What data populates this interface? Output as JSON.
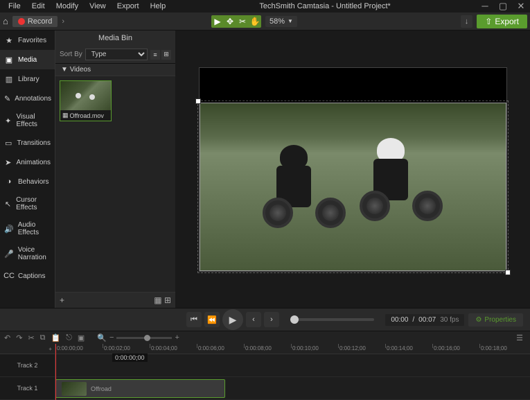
{
  "menu": {
    "file": "File",
    "edit": "Edit",
    "modify": "Modify",
    "view": "View",
    "export": "Export",
    "help": "Help"
  },
  "title": "TechSmith Camtasia - Untitled Project*",
  "toolbar": {
    "record": "Record",
    "zoom": "58%",
    "export": "Export"
  },
  "sidebar": {
    "items": [
      {
        "label": "Favorites",
        "icon": "★"
      },
      {
        "label": "Media",
        "icon": "▣"
      },
      {
        "label": "Library",
        "icon": "▥"
      },
      {
        "label": "Annotations",
        "icon": "✎"
      },
      {
        "label": "Visual Effects",
        "icon": "✦"
      },
      {
        "label": "Transitions",
        "icon": "▭"
      },
      {
        "label": "Animations",
        "icon": "➤"
      },
      {
        "label": "Behaviors",
        "icon": "◑"
      },
      {
        "label": "Cursor Effects",
        "icon": "↖"
      },
      {
        "label": "Audio Effects",
        "icon": "🔊"
      },
      {
        "label": "Voice Narration",
        "icon": "🎤"
      },
      {
        "label": "Captions",
        "icon": "CC"
      }
    ]
  },
  "mediaPanel": {
    "title": "Media Bin",
    "sortLabel": "Sort By",
    "sortValue": "Type",
    "section": "Videos",
    "clip": {
      "name": "Offroad.mov"
    }
  },
  "playback": {
    "current": "00:00",
    "total": "00:07",
    "fps": "30 fps",
    "properties": "Properties"
  },
  "timeline": {
    "timecode": "0:00:00;00",
    "tracks": [
      "Track 2",
      "Track 1"
    ],
    "clipName": "Offroad",
    "ticks": [
      "0:00:00;00",
      "0:00:02;00",
      "0:00:04;00",
      "0:00:06;00",
      "0:00:08;00",
      "0:00:10;00",
      "0:00:12;00",
      "0:00:14;00",
      "0:00:16;00",
      "0:00:18;00"
    ]
  }
}
